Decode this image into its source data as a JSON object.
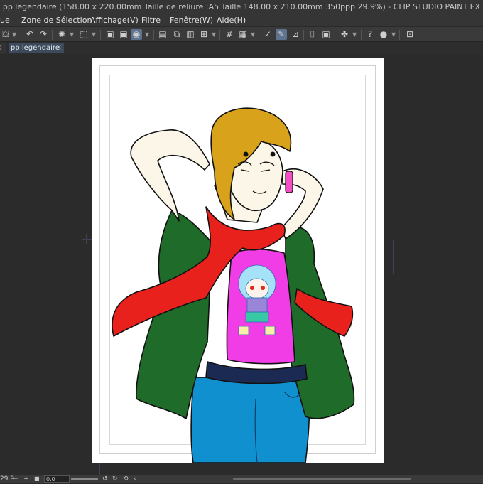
{
  "window": {
    "title": "pp legendaire (158.00 x 220.00mm Taille de reliure :A5 Taille 148.00 x 210.00mm 350ppp 29.9%)  - CLIP STUDIO PAINT EX"
  },
  "menu": {
    "items": [
      "ue",
      "Zone de Sélection",
      "Affichage(V)",
      "Filtre",
      "Fenêtre(W)",
      "Aide(H)"
    ]
  },
  "toolbar": {
    "icons": [
      "layers",
      "undo",
      "redo",
      "loading",
      "transform",
      "save-dark",
      "save-light",
      "rotate-view",
      "layer-panel",
      "layer-copy",
      "layer-list",
      "grid",
      "grid-alt",
      "check-pen",
      "pen-active",
      "ruler",
      "frame",
      "frame-alt",
      "symbols",
      "help",
      "circle",
      "snap"
    ]
  },
  "document_tab": {
    "label": "pp legendaire",
    "close": "×"
  },
  "colors": {
    "skin": "#fbf6e8",
    "hair": "#d9a21b",
    "jacket": "#1f6b2a",
    "scarf": "#e8211c",
    "shirt": "#f13de6",
    "jeans": "#1190d0",
    "belt": "#1a2a52",
    "bracelet": "#f24fc6"
  },
  "status": {
    "zoom": "29.9",
    "minus": "−",
    "plus": "+",
    "rotation": "0.0"
  }
}
